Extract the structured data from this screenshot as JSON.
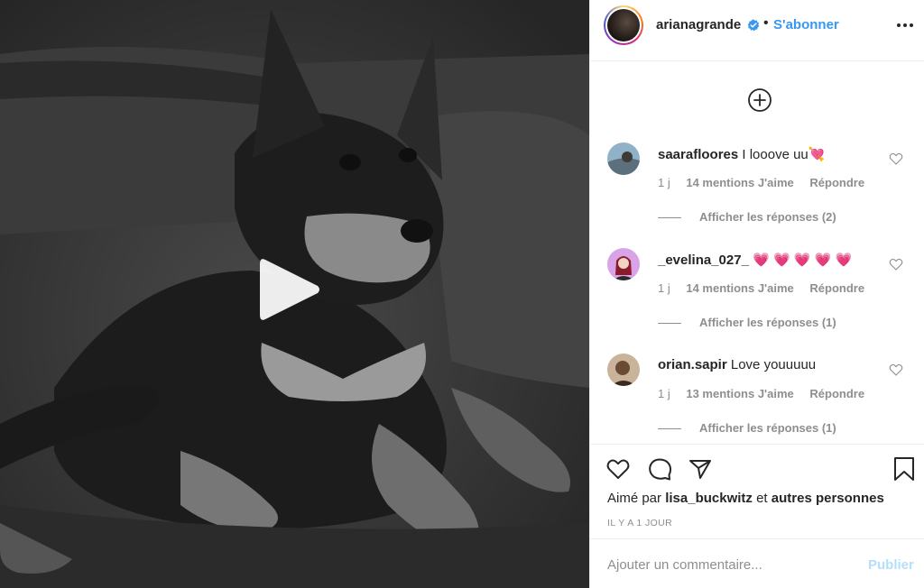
{
  "post": {
    "author": "arianagrande",
    "separator": "•",
    "follow_label": "S'abonner",
    "avatar_icon": "profile-photo",
    "verified_icon": "verified-badge-icon",
    "more_icon": "more-options-icon",
    "video_play_icon": "play-icon"
  },
  "comments": [
    {
      "user": "saarafloores",
      "text": "I looove uu💘",
      "age": "1 j",
      "likes": "14 mentions J'aime",
      "reply": "Répondre",
      "view_replies": "Afficher les réponses (2)"
    },
    {
      "user": "_evelina_027_",
      "text": "💗 💗 💗 💗 💗",
      "age": "1 j",
      "likes": "14 mentions J'aime",
      "reply": "Répondre",
      "view_replies": "Afficher les réponses (1)"
    },
    {
      "user": "orian.sapir",
      "text": "Love youuuuu",
      "age": "1 j",
      "likes": "13 mentions J'aime",
      "reply": "Répondre",
      "view_replies": "Afficher les réponses (1)"
    }
  ],
  "liked": {
    "prefix": "Aimé par",
    "user": "lisa_buckwitz",
    "conj": "et",
    "others": "autres personnes"
  },
  "timestamp": "IL Y A 1 JOUR",
  "composer": {
    "placeholder": "Ajouter un commentaire...",
    "publish_label": "Publier"
  },
  "colors": {
    "link_blue": "#3897f0",
    "publish_disabled": "#b2dffc",
    "muted_text": "#8e8e8e",
    "text": "#262626",
    "heart_emoji": "#e0218a"
  }
}
